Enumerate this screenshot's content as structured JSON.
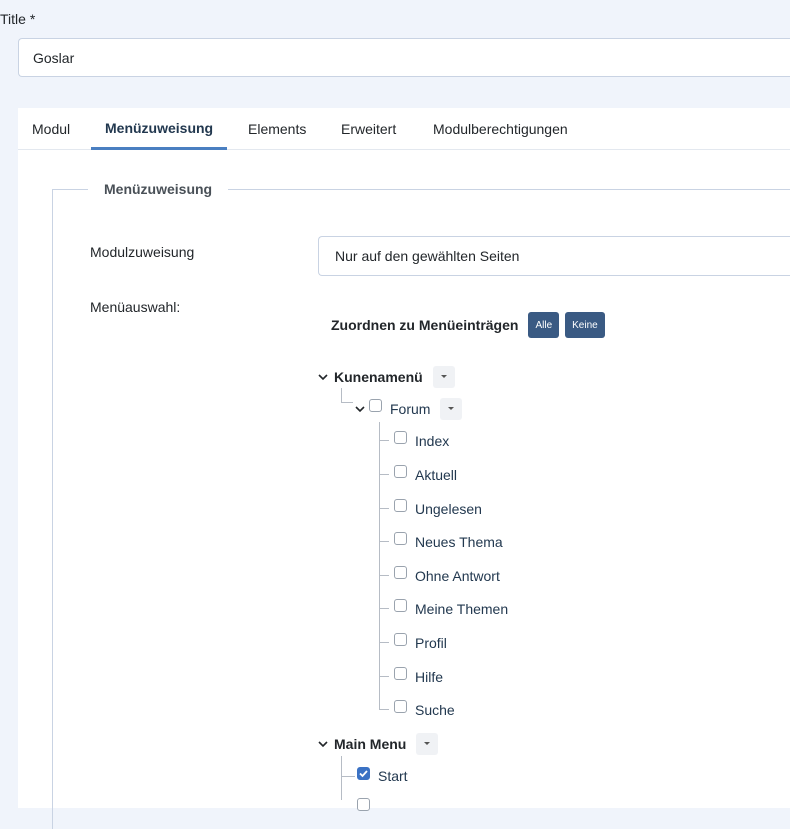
{
  "title_field": {
    "label": "Title *",
    "value": "Goslar"
  },
  "tabs": [
    {
      "label": "Modul"
    },
    {
      "label": "Menüzuweisung"
    },
    {
      "label": "Elements"
    },
    {
      "label": "Erweitert"
    },
    {
      "label": "Modulberechtigungen"
    }
  ],
  "fieldset": {
    "legend": "Menüzuweisung"
  },
  "module_assignment": {
    "label": "Modulzuweisung",
    "value": "Nur auf den gewählten Seiten"
  },
  "menu_selection": {
    "label": "Menüauswahl:",
    "assign_title": "Zuordnen zu Menüeinträgen",
    "all_label": "Alle",
    "none_label": "Keine"
  },
  "menus": {
    "kunena": {
      "name": "Kunenamenü",
      "forum": {
        "label": "Forum",
        "items": [
          {
            "label": "Index",
            "checked": false
          },
          {
            "label": "Aktuell",
            "checked": false
          },
          {
            "label": "Ungelesen",
            "checked": false
          },
          {
            "label": "Neues Thema",
            "checked": false
          },
          {
            "label": "Ohne Antwort",
            "checked": false
          },
          {
            "label": "Meine Themen",
            "checked": false
          },
          {
            "label": "Profil",
            "checked": false
          },
          {
            "label": "Hilfe",
            "checked": false
          },
          {
            "label": "Suche",
            "checked": false
          }
        ]
      }
    },
    "main": {
      "name": "Main Menu",
      "items": [
        {
          "label": "Start",
          "checked": true
        }
      ]
    }
  },
  "colors": {
    "accent": "#4a7fc1",
    "button": "#3a5a83",
    "checkbox_checked": "#3b72c4"
  }
}
